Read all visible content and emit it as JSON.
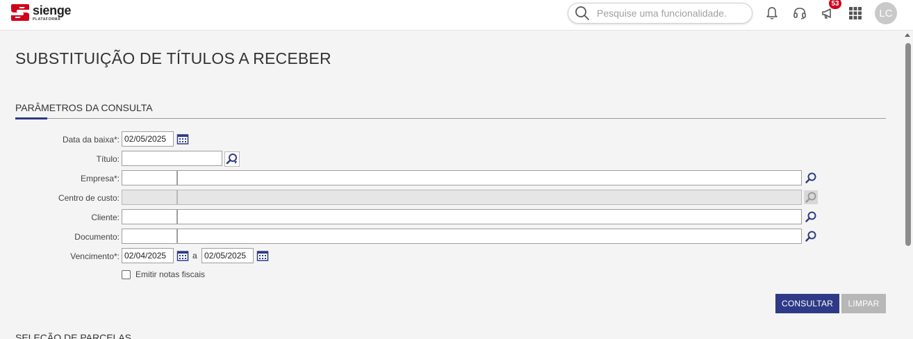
{
  "header": {
    "logo_name": "sienge",
    "logo_sub": "PLATAFORMA",
    "search_placeholder": "Pesquise uma funcionalidade.",
    "notification_badge": "53",
    "avatar_initials": "LC",
    "icons": [
      "bell-icon",
      "headset-icon",
      "megaphone-icon",
      "apps-grid-icon"
    ]
  },
  "page": {
    "title": "SUBSTITUIÇÃO DE TÍTULOS A RECEBER"
  },
  "params": {
    "section_title": "PARÂMETROS DA CONSULTA",
    "data_baixa_label": "Data da baixa*:",
    "data_baixa_value": "02/05/2025",
    "titulo_label": "Título:",
    "titulo_value": "",
    "empresa_label": "Empresa*:",
    "empresa_code": "",
    "empresa_name": "",
    "centro_label": "Centro de custo:",
    "centro_code": "",
    "centro_name": "",
    "cliente_label": "Cliente:",
    "cliente_code": "",
    "cliente_name": "",
    "documento_label": "Documento:",
    "documento_code": "",
    "documento_name": "",
    "vencimento_label": "Vencimento*:",
    "vencimento_from": "02/04/2025",
    "vencimento_sep": "a",
    "vencimento_to": "02/05/2025",
    "emitir_label": "Emitir notas fiscais",
    "emitir_checked": false
  },
  "actions": {
    "consultar": "CONSULTAR",
    "limpar": "LIMPAR"
  },
  "selection": {
    "section_title": "SELEÇÃO DE PARCELAS"
  },
  "colors": {
    "primary": "#2e3a87",
    "brand_red": "#d0021b",
    "disabled_button": "#b7b7b7"
  }
}
